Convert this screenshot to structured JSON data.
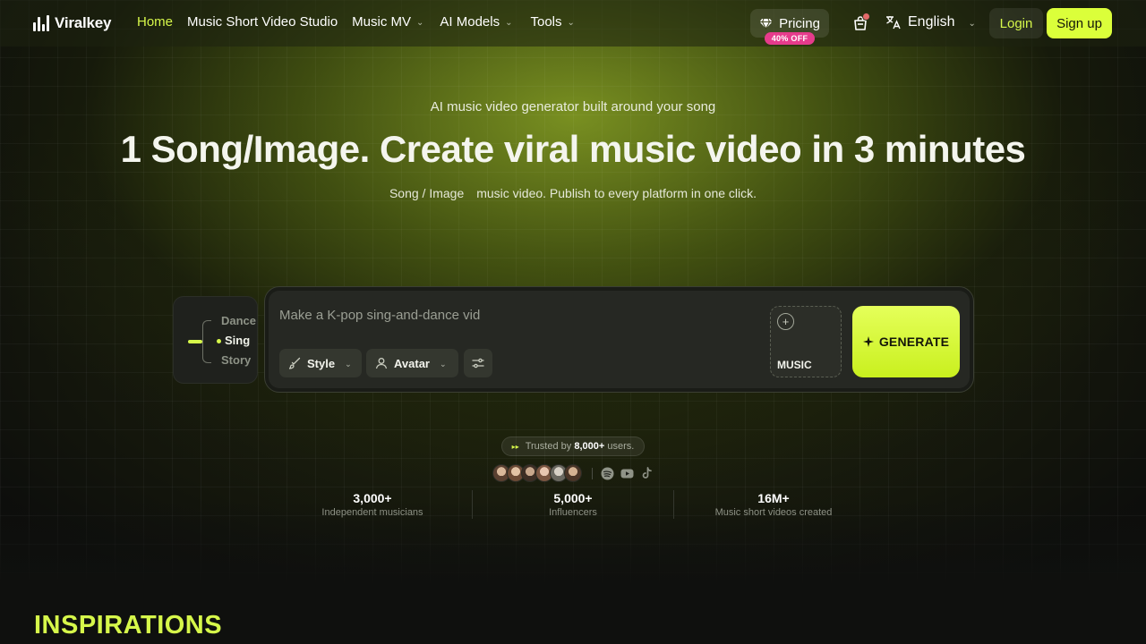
{
  "nav": {
    "logo": "Viralkey",
    "links": [
      {
        "label": "Home",
        "active": true,
        "dropdown": false
      },
      {
        "label": "Music Short Video Studio",
        "active": false,
        "dropdown": false
      },
      {
        "label": "Music MV",
        "active": false,
        "dropdown": true
      },
      {
        "label": "AI Models",
        "active": false,
        "dropdown": true
      },
      {
        "label": "Tools",
        "active": false,
        "dropdown": true
      }
    ],
    "pricing": "Pricing",
    "discount": "40% OFF",
    "language": "English",
    "login": "Login",
    "signup": "Sign up"
  },
  "hero": {
    "eyebrow": "AI music video generator built around your song",
    "headline": "1 Song/Image. Create viral music video in 3 minutes",
    "sub_part1": "Song / Image",
    "sub_part2": "music video. Publish to every platform in one click."
  },
  "modes": {
    "items": [
      "Dance",
      "Sing",
      "Story"
    ],
    "selected": "Sing"
  },
  "prompt": {
    "placeholder": "Make a K-pop sing-and-dance vid",
    "style_label": "Style",
    "avatar_label": "Avatar",
    "music_label": "MUSIC",
    "generate_label": "GENERATE"
  },
  "trust": {
    "prefix": "Trusted by",
    "count": "8,000+",
    "suffix": "users."
  },
  "stats": [
    {
      "value": "3,000+",
      "label": "Independent musicians"
    },
    {
      "value": "5,000+",
      "label": "Influencers"
    },
    {
      "value": "16M+",
      "label": "Music short videos created"
    }
  ],
  "section_title": "INSPIRATIONS",
  "colors": {
    "accent": "#d6f74a",
    "signup_bg": "#dbff3a",
    "discount_badge": "#e63b8c"
  },
  "icons": [
    "logo-icon",
    "diamond-icon",
    "bag-icon",
    "translate-icon",
    "chevron-down-icon",
    "brush-icon",
    "user-icon",
    "sliders-icon",
    "plus-icon",
    "sparkle-icon",
    "spotify-icon",
    "youtube-icon",
    "tiktok-icon"
  ]
}
